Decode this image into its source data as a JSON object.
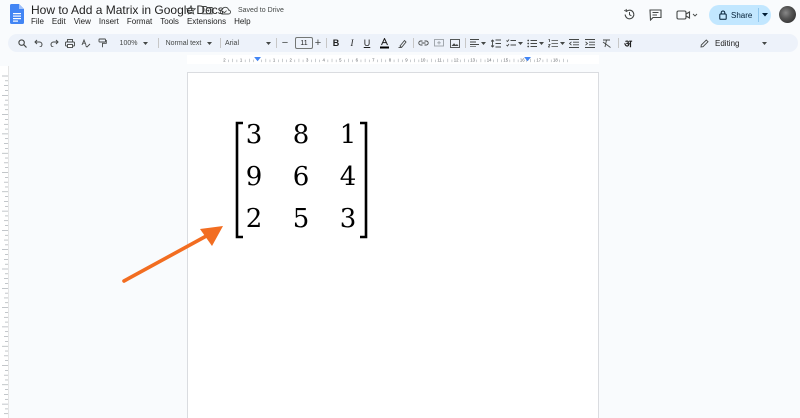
{
  "document": {
    "title": "How to Add a Matrix in Google Docs",
    "saved_status": "Saved to Drive"
  },
  "menu": [
    "File",
    "Edit",
    "View",
    "Insert",
    "Format",
    "Tools",
    "Extensions",
    "Help"
  ],
  "header_actions": {
    "share_label": "Share"
  },
  "toolbar": {
    "zoom": "100%",
    "style": "Normal text",
    "font": "Arial",
    "font_size": "11",
    "mode": "Editing"
  },
  "ruler": {
    "numbers": [
      "2",
      "1",
      "1",
      "2",
      "3",
      "4",
      "5",
      "6",
      "7",
      "8",
      "9",
      "10",
      "11",
      "12",
      "13",
      "14",
      "15",
      "16",
      "17",
      "18"
    ]
  },
  "matrix": {
    "rows": [
      [
        "3",
        "8",
        "1"
      ],
      [
        "9",
        "6",
        "4"
      ],
      [
        "2",
        "5",
        "3"
      ]
    ]
  },
  "colors": {
    "accent": "#c2e7ff",
    "toolbar_bg": "#edf2fa",
    "arrow": "#f26d21",
    "docs_blue": "#4285f4"
  }
}
